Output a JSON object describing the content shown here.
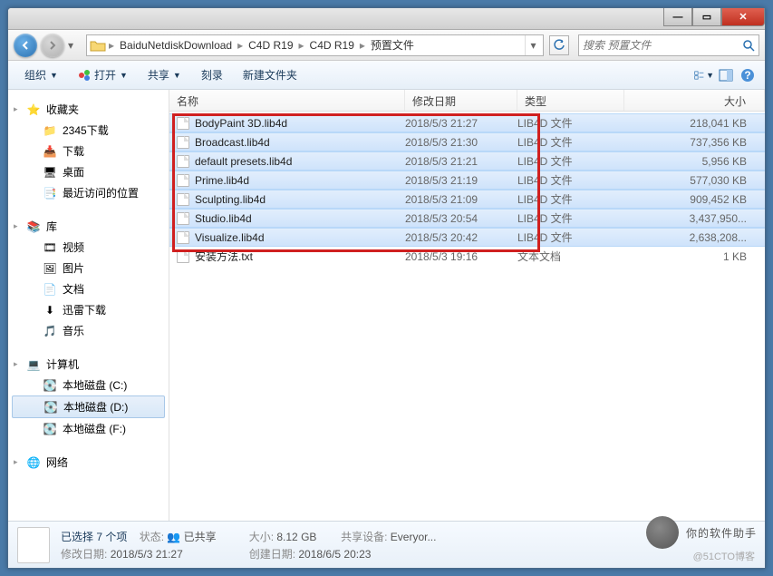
{
  "window": {
    "min": "—",
    "max": "▭",
    "close": "✕"
  },
  "breadcrumb": [
    "BaiduNetdiskDownload",
    "C4D  R19",
    "C4D R19",
    "预置文件"
  ],
  "search": {
    "placeholder": "搜索 预置文件"
  },
  "toolbar": {
    "organize": "组织",
    "open": "打开",
    "share": "共享",
    "burn": "刻录",
    "newfolder": "新建文件夹"
  },
  "sidebar": {
    "favorites": {
      "label": "收藏夹",
      "items": [
        "2345下载",
        "下载",
        "桌面",
        "最近访问的位置"
      ]
    },
    "libraries": {
      "label": "库",
      "items": [
        "视频",
        "图片",
        "文档",
        "迅雷下载",
        "音乐"
      ]
    },
    "computer": {
      "label": "计算机",
      "items": [
        "本地磁盘 (C:)",
        "本地磁盘 (D:)",
        "本地磁盘 (F:)"
      ]
    },
    "network": {
      "label": "网络"
    }
  },
  "columns": {
    "name": "名称",
    "date": "修改日期",
    "type": "类型",
    "size": "大小"
  },
  "files": [
    {
      "name": "BodyPaint 3D.lib4d",
      "date": "2018/5/3 21:27",
      "type": "LIB4D 文件",
      "size": "218,041 KB",
      "sel": true
    },
    {
      "name": "Broadcast.lib4d",
      "date": "2018/5/3 21:30",
      "type": "LIB4D 文件",
      "size": "737,356 KB",
      "sel": true
    },
    {
      "name": "default presets.lib4d",
      "date": "2018/5/3 21:21",
      "type": "LIB4D 文件",
      "size": "5,956 KB",
      "sel": true
    },
    {
      "name": "Prime.lib4d",
      "date": "2018/5/3 21:19",
      "type": "LIB4D 文件",
      "size": "577,030 KB",
      "sel": true
    },
    {
      "name": "Sculpting.lib4d",
      "date": "2018/5/3 21:09",
      "type": "LIB4D 文件",
      "size": "909,452 KB",
      "sel": true
    },
    {
      "name": "Studio.lib4d",
      "date": "2018/5/3 20:54",
      "type": "LIB4D 文件",
      "size": "3,437,950...",
      "sel": true
    },
    {
      "name": "Visualize.lib4d",
      "date": "2018/5/3 20:42",
      "type": "LIB4D 文件",
      "size": "2,638,208...",
      "sel": true
    },
    {
      "name": "安装方法.txt",
      "date": "2018/5/3 19:16",
      "type": "文本文档",
      "size": "1 KB",
      "sel": false
    }
  ],
  "details": {
    "selection": "已选择 7 个项",
    "status_l": "状态:",
    "status_v": "已共享",
    "moddate_l": "修改日期:",
    "moddate_v": "2018/5/3 21:27",
    "size_l": "大小:",
    "size_v": "8.12 GB",
    "created_l": "创建日期:",
    "created_v": "2018/6/5 20:23",
    "share_l": "共享设备:",
    "share_v": "Everyor..."
  },
  "watermark": {
    "text": "你的软件助手",
    "small": "@51CTO博客"
  }
}
